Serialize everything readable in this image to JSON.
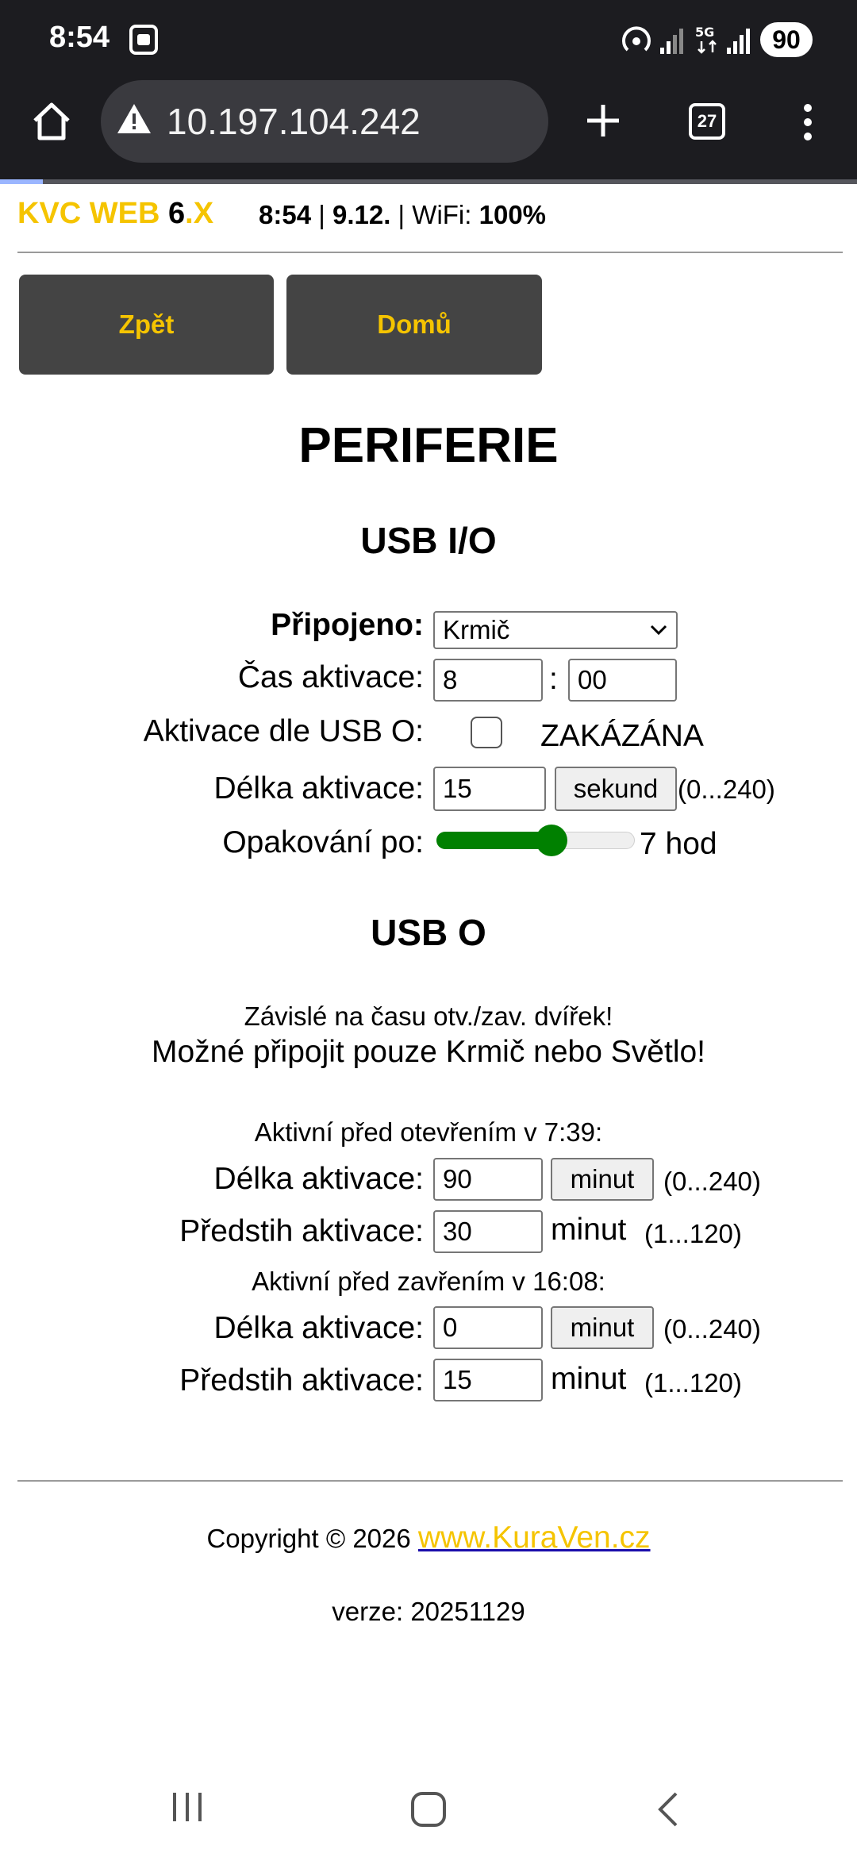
{
  "status_bar": {
    "time": "8:54",
    "battery": "90"
  },
  "browser": {
    "url": "10.197.104.242",
    "tab_count": "27"
  },
  "header": {
    "brand_kvc": "KVC WEB",
    "brand_six": "6",
    "brand_x": ".X",
    "time": "8:54",
    "sep1": " | ",
    "date": "9.12.",
    "wifi_label": " | WiFi: ",
    "wifi_value": "100%"
  },
  "nav": {
    "back_label": "Zpět",
    "home_label": "Domů"
  },
  "page_title": "PERIFERIE",
  "usb_io": {
    "title": "USB I/O",
    "connected_label": "Připojeno:",
    "connected_value": "Krmič",
    "activation_time_label": "Čas aktivace:",
    "hour": "8",
    "colon": ":",
    "minute": "00",
    "usb_o_activation_label": "Aktivace dle USB O:",
    "usb_o_activation_state": "ZAKÁZÁNA",
    "duration_label": "Délka aktivace:",
    "duration_value": "15",
    "duration_unit": "sekund",
    "duration_range": "(0...240)",
    "repeat_label": "Opakování po:",
    "repeat_value": "7 hod",
    "repeat_fraction": 0.58
  },
  "usb_o": {
    "title": "USB O",
    "note1": "Závislé na času otv./zav. dvířek!",
    "note2": "Možné připojit pouze Krmič nebo Světlo!",
    "open_section": "Aktivní před otevřením v 7:39:",
    "open_duration_label": "Délka aktivace:",
    "open_duration_value": "90",
    "open_duration_unit": "minut",
    "open_duration_range": "(0...240)",
    "open_advance_label": "Předstih aktivace:",
    "open_advance_value": "30",
    "open_advance_unit": "minut",
    "open_advance_range": "(1...120)",
    "close_section": "Aktivní před zavřením v 16:08:",
    "close_duration_label": "Délka aktivace:",
    "close_duration_value": "0",
    "close_duration_unit": "minut",
    "close_duration_range": "(0...240)",
    "close_advance_label": "Předstih aktivace:",
    "close_advance_value": "15",
    "close_advance_unit": "minut",
    "close_advance_range": "(1...120)"
  },
  "footer": {
    "copyright": "Copyright © 2026 ",
    "link": "www.KuraVen.cz",
    "version": "verze: 20251129"
  },
  "colors": {
    "brand_yellow": "#f5c400",
    "slider_green": "#008000",
    "button_dark": "#444444"
  }
}
